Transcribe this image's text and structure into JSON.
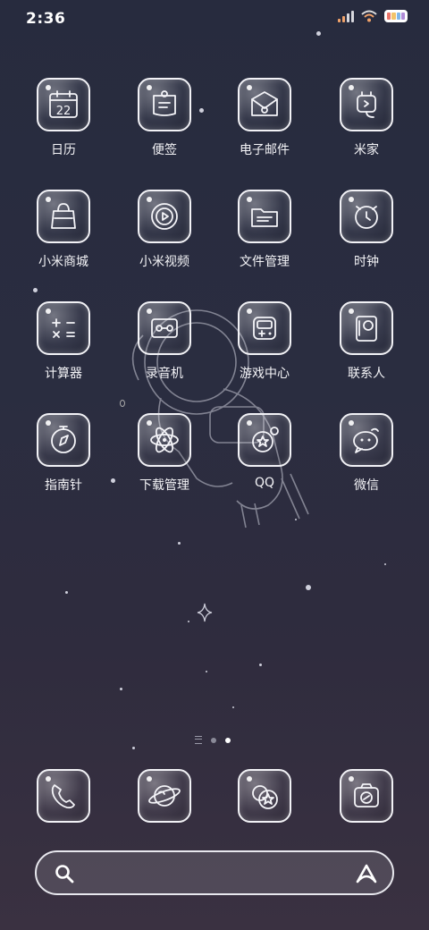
{
  "status_bar": {
    "time": "2:36"
  },
  "apps": [
    {
      "label": "日历",
      "icon": "calendar-icon",
      "day": "22"
    },
    {
      "label": "便签",
      "icon": "notes-icon"
    },
    {
      "label": "电子邮件",
      "icon": "email-icon"
    },
    {
      "label": "米家",
      "icon": "smart-plug-icon"
    },
    {
      "label": "小米商城",
      "icon": "shopping-bag-icon"
    },
    {
      "label": "小米视频",
      "icon": "video-play-icon"
    },
    {
      "label": "文件管理",
      "icon": "folder-icon"
    },
    {
      "label": "时钟",
      "icon": "alarm-clock-icon"
    },
    {
      "label": "计算器",
      "icon": "calculator-icon"
    },
    {
      "label": "录音机",
      "icon": "cassette-icon"
    },
    {
      "label": "游戏中心",
      "icon": "gamepad-icon"
    },
    {
      "label": "联系人",
      "icon": "contacts-book-icon"
    },
    {
      "label": "指南针",
      "icon": "compass-icon"
    },
    {
      "label": "下载管理",
      "icon": "atom-icon"
    },
    {
      "label": "QQ",
      "icon": "qq-icon"
    },
    {
      "label": "微信",
      "icon": "chat-bubbles-icon"
    }
  ],
  "dock": [
    {
      "icon": "phone-icon"
    },
    {
      "icon": "planet-browser-icon"
    },
    {
      "icon": "messages-icon"
    },
    {
      "icon": "camera-icon"
    }
  ],
  "page_indicator": {
    "pages": 2,
    "active": 2
  },
  "search": {
    "placeholder": ""
  }
}
